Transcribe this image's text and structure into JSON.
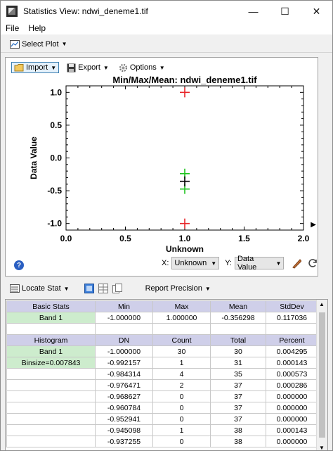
{
  "window": {
    "title": "Statistics View: ndwi_deneme1.tif",
    "minimize": "—",
    "maximize": "☐",
    "close": "✕"
  },
  "menu": [
    "File",
    "Help"
  ],
  "select_plot": "Select Plot",
  "plot_toolbar": {
    "import": "Import",
    "export": "Export",
    "options": "Options"
  },
  "axis_select": {
    "x_label": "X:",
    "x_value": "Unknown",
    "y_label": "Y:",
    "y_value": "Data Value"
  },
  "chart_data": {
    "type": "scatter",
    "title": "Min/Max/Mean: ndwi_deneme1.tif",
    "xlabel": "Unknown",
    "ylabel": "Data Value",
    "xlim": [
      0.0,
      2.0
    ],
    "ylim": [
      -1.1,
      1.1
    ],
    "xticks": [
      "0.0",
      "0.5",
      "1.0",
      "1.5",
      "2.0"
    ],
    "yticks": [
      "1.0",
      "0.5",
      "0.0",
      "-0.5",
      "-1.0"
    ],
    "series": [
      {
        "color": "#e8262a",
        "points": [
          [
            1.0,
            1.0
          ],
          [
            1.0,
            -1.0
          ]
        ]
      },
      {
        "color": "#1fc51f",
        "points": [
          [
            1.0,
            -0.239
          ],
          [
            1.0,
            -0.474
          ]
        ]
      },
      {
        "color": "#000000",
        "points": [
          [
            1.0,
            -0.356298
          ]
        ]
      }
    ],
    "marker": "plus"
  },
  "stat_toolbar": {
    "locate_stat": "Locate Stat",
    "report_precision": "Report Precision"
  },
  "basic_stats": {
    "headers": [
      "Basic Stats",
      "Min",
      "Max",
      "Mean",
      "StdDev"
    ],
    "row": [
      "Band 1",
      "-1.000000",
      "1.000000",
      "-0.356298",
      "0.117036"
    ]
  },
  "histogram": {
    "headers": [
      "Histogram",
      "DN",
      "Count",
      "Total",
      "Percent"
    ],
    "labels": [
      "Band 1",
      "Binsize=0.007843"
    ],
    "rows": [
      [
        "-1.000000",
        "30",
        "30",
        "0.004295"
      ],
      [
        "-0.992157",
        "1",
        "31",
        "0.000143"
      ],
      [
        "-0.984314",
        "4",
        "35",
        "0.000573"
      ],
      [
        "-0.976471",
        "2",
        "37",
        "0.000286"
      ],
      [
        "-0.968627",
        "0",
        "37",
        "0.000000"
      ],
      [
        "-0.960784",
        "0",
        "37",
        "0.000000"
      ],
      [
        "-0.952941",
        "0",
        "37",
        "0.000000"
      ],
      [
        "-0.945098",
        "1",
        "38",
        "0.000143"
      ],
      [
        "-0.937255",
        "0",
        "38",
        "0.000000"
      ]
    ]
  }
}
